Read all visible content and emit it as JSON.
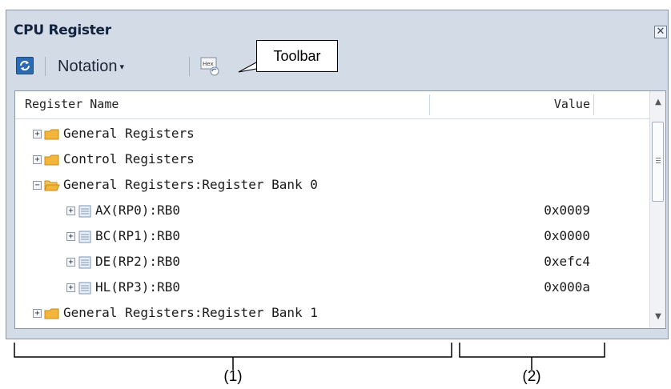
{
  "window": {
    "title": "CPU Register",
    "close_icon_glyph": "✕"
  },
  "toolbar": {
    "refresh_icon": "refresh-icon",
    "notation_label": "Notation",
    "notation_caret": "▾",
    "hex_icon": "hex-display-icon",
    "callout_label": "Toolbar"
  },
  "table": {
    "col_name": "Register Name",
    "col_value": "Value",
    "rows": [
      {
        "label": "General Registers",
        "value": "",
        "expander": "+",
        "icon": "folder-icon"
      },
      {
        "label": "Control Registers",
        "value": "",
        "expander": "+",
        "icon": "folder-icon"
      },
      {
        "label": "General Registers:Register Bank 0",
        "value": "",
        "expander": "−",
        "icon": "folder-open-icon"
      },
      {
        "label": "AX(RP0):RB0",
        "value": "0x0009",
        "expander": "+",
        "icon": "register-icon"
      },
      {
        "label": "BC(RP1):RB0",
        "value": "0x0000",
        "expander": "+",
        "icon": "register-icon"
      },
      {
        "label": "DE(RP2):RB0",
        "value": "0xefc4",
        "expander": "+",
        "icon": "register-icon"
      },
      {
        "label": "HL(RP3):RB0",
        "value": "0x000a",
        "expander": "+",
        "icon": "register-icon"
      },
      {
        "label": "General Registers:Register Bank 1",
        "value": "",
        "expander": "+",
        "icon": "folder-icon"
      }
    ]
  },
  "scrollbar": {
    "up": "▲",
    "down": "▼"
  },
  "annotations": {
    "label_1": "(1)",
    "label_2": "(2)"
  },
  "colors": {
    "window_bg": "#d3dbe6",
    "folder": "#f2b63a",
    "refresh": "#2d6bb0"
  }
}
